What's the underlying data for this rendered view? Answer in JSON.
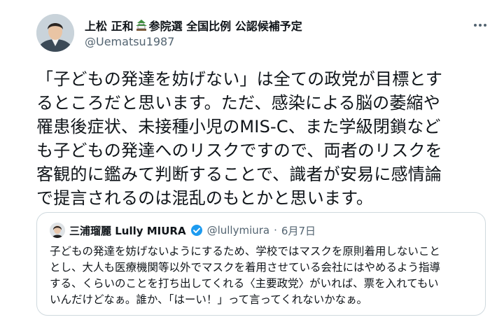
{
  "author": {
    "name_prefix": "上松 正和",
    "name_suffix": "参院選 全国比例 公認候補予定",
    "handle": "@Uematsu1987",
    "flag_icon": "japanese-castle-icon"
  },
  "tweet": {
    "text": "「子どもの発達を妨げない」は全ての政党が目標とす\nるところだと思います。ただ、感染による脳の萎縮や\n罹患後症状、未接種小児のMIS-C、また学級閉鎖など\nも子どもの発達へのリスクですので、両者のリスクを\n客観的に鑑みて判断することで、識者が安易に感情論\nで提言されるのは混乱のもとかと思います。"
  },
  "quoted": {
    "name": "三浦瑠麗 Lully MIURA",
    "handle": "@lullymiura",
    "separator": "·",
    "date": "6月7日",
    "verified_color": "#1d9bf0",
    "text": "子どもの発達を妨げないようにするため、学校ではマスクを原則着用しないこと\nとし、大人も医療機関等以外でマスクを着用させている会社にはやめるよう指導\nする、くらいのことを打ち出してくれる〈主要政党〉がいれば、票を入れてもい\nいんだけどなぁ。誰か、「はーい！」って言ってくれないかなぁ。"
  },
  "colors": {
    "text": "#0f1419",
    "secondary": "#536471",
    "border": "#cfd9de"
  }
}
